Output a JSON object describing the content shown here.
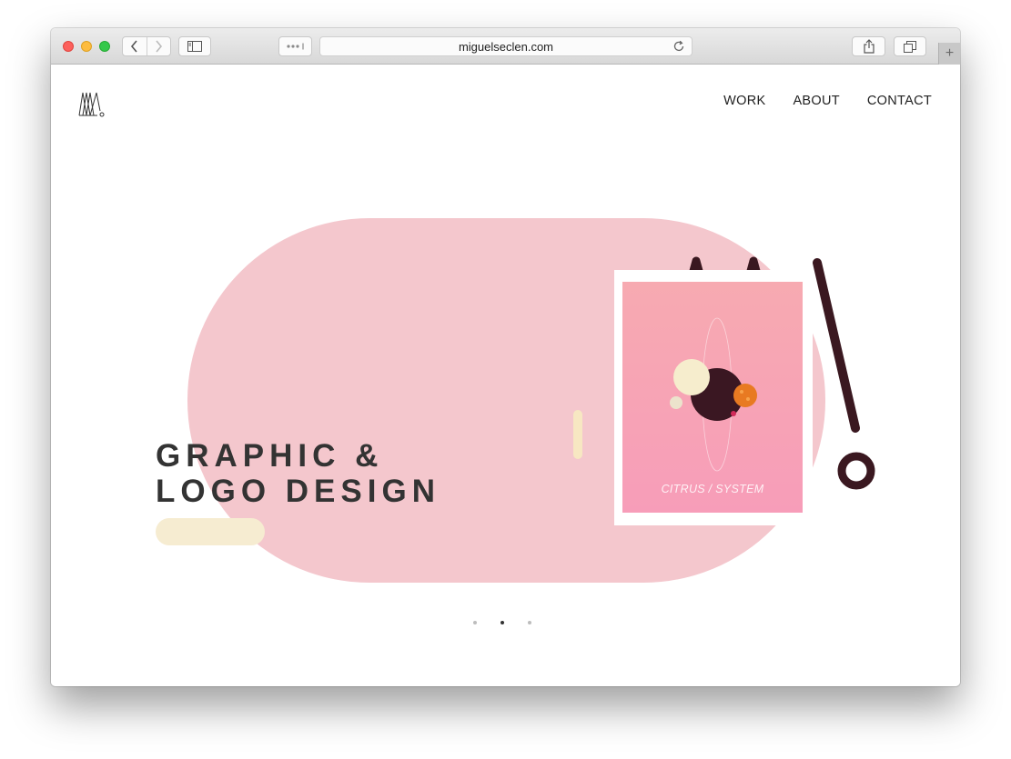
{
  "browser": {
    "url": "miguelseclen.com",
    "icons": {
      "back": "chevron-left-icon",
      "forward": "chevron-right-icon",
      "sidebar": "sidebar-icon",
      "reader": "more-dots-icon",
      "reload": "reload-icon",
      "share": "share-icon",
      "tabs": "tabs-icon",
      "new_tab": "plus-icon"
    }
  },
  "site": {
    "logo_name": "ms-monogram-logo",
    "nav": {
      "work": "WORK",
      "about": "ABOUT",
      "contact": "CONTACT"
    },
    "hero": {
      "line1": "GRAPHIC &",
      "line2": "LOGO DESIGN"
    },
    "card": {
      "title": "CITRUS / SYSTEM"
    },
    "slider": {
      "count": 3,
      "active_index": 1
    },
    "colors": {
      "blob": "#f4c7cd",
      "accent_dark": "#3a1820",
      "cream": "#f6ecd1",
      "text": "#333333"
    }
  }
}
